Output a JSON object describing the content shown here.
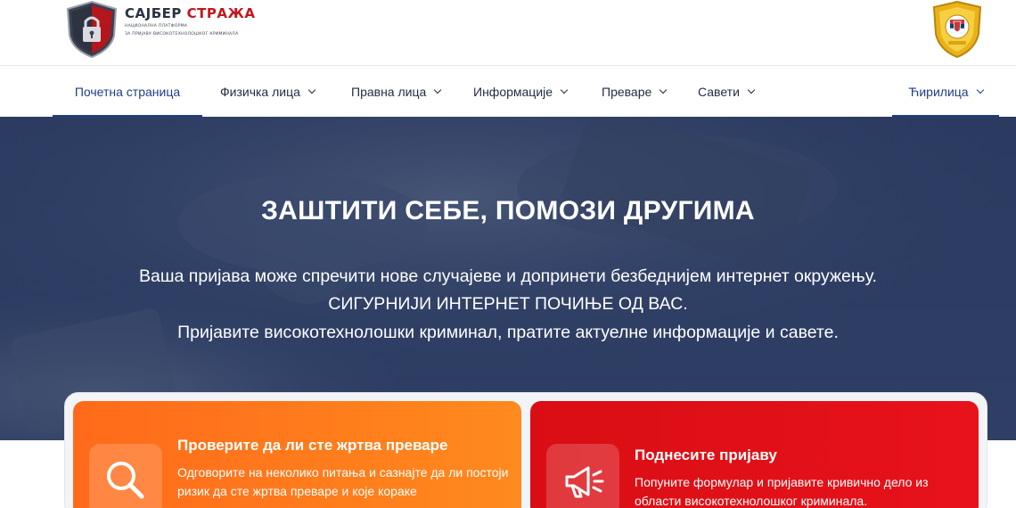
{
  "header": {
    "logo_title_a": "САЈБЕР",
    "logo_title_b": "СТРАЖА",
    "logo_sub_1": "НАЦИОНАЛНА ПЛАТФОРМА",
    "logo_sub_2": "ЗА ПРИЈАВУ ВИСОКОТЕХНОЛОШКОГ КРИМИНАЛА"
  },
  "nav": {
    "items": [
      {
        "label": "Почетна страница"
      },
      {
        "label": "Физичка лица"
      },
      {
        "label": "Правна лица"
      },
      {
        "label": "Информације"
      },
      {
        "label": "Преваре"
      },
      {
        "label": "Савети"
      }
    ],
    "language": "Ћирилица"
  },
  "hero": {
    "title": "ЗАШТИТИ СЕБЕ, ПОМОЗИ ДРУГИМА",
    "line1": "Ваша пријава може спречити нове случајеве и допринети безбеднијем интернет окружењу.",
    "line2": "СИГУРНИЈИ ИНТЕРНЕТ ПОЧИЊЕ ОД ВАС.",
    "line3": "Пријавите високотехнолошки криминал, пратите актуелне информације и савете."
  },
  "cards": [
    {
      "title": "Проверите да ли сте жртва преваре",
      "text": "Одговорите на неколико питања и сазнајте да ли постоји ризик да сте жртва преваре и које кораке",
      "icon": "search-icon",
      "color": "#ff7a1c"
    },
    {
      "title": "Поднесите пријаву",
      "text": "Попуните формулар и пријавите кривично дело из области високотехнолошког криминала.",
      "icon": "megaphone-icon",
      "color": "#e0121a"
    }
  ],
  "colors": {
    "accent": "#1e3f82",
    "hero_bg": "#2c3c62",
    "brand_red": "#c4161c"
  }
}
